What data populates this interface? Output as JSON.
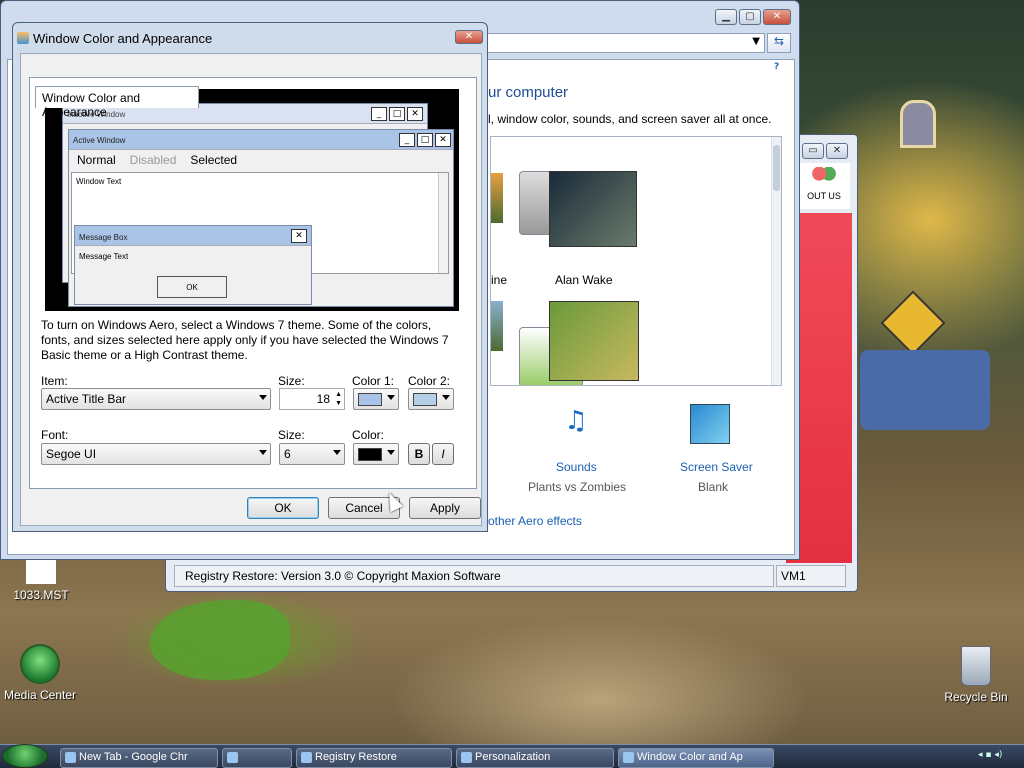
{
  "desktop": {
    "icons": [
      {
        "label": "1033.MST"
      },
      {
        "label": "Media Center"
      },
      {
        "label": "Recycle Bin"
      }
    ]
  },
  "taskbar": {
    "buttons": [
      {
        "label": "New Tab - Google Chr"
      },
      {
        "label": ""
      },
      {
        "label": "Registry Restore"
      },
      {
        "label": "Personalization"
      },
      {
        "label": "Window Color and Ap"
      }
    ]
  },
  "personalization": {
    "heading": "ur computer",
    "subheading": "l, window color, sounds, and screen saver all at once.",
    "themes": [
      {
        "label": "ine"
      },
      {
        "label": "Alan Wake"
      }
    ],
    "sounds_label": "Sounds",
    "sounds_value": "Plants vs Zombies",
    "screensaver_label": "Screen Saver",
    "screensaver_value": "Blank",
    "aero_link": "other Aero effects",
    "help_icon": "?"
  },
  "registry": {
    "about_label": "OUT US",
    "status_text": "Registry Restore: Version 3.0 © Copyright Maxion Software",
    "status_right": "VM1"
  },
  "dialog": {
    "title": "Window Color and Appearance",
    "tab_label": "Window Color and Appearance",
    "preview": {
      "inactive_title": "Inactive Window",
      "active_title": "Active Window",
      "menu_normal": "Normal",
      "menu_disabled": "Disabled",
      "menu_selected": "Selected",
      "window_text": "Window Text",
      "message_box_title": "Message Box",
      "message_text": "Message Text",
      "ok": "OK"
    },
    "description": "To turn on Windows Aero, select a Windows 7 theme.  Some of the colors, fonts, and sizes selected here apply only if you have selected the Windows 7 Basic theme or a High Contrast theme.",
    "item_label": "Item:",
    "item_value": "Active Title Bar",
    "size_label": "Size:",
    "size_value": "18",
    "color1_label": "Color 1:",
    "color1_value": "#a9c4e6",
    "color2_label": "Color 2:",
    "color2_value": "#b6cfe8",
    "font_label": "Font:",
    "font_value": "Segoe UI",
    "font_size_label": "Size:",
    "font_size_value": "6",
    "font_color_label": "Color:",
    "font_color_value": "#000000",
    "bold_label": "B",
    "italic_label": "I",
    "ok_button": "OK",
    "cancel_button": "Cancel",
    "apply_button": "Apply"
  }
}
